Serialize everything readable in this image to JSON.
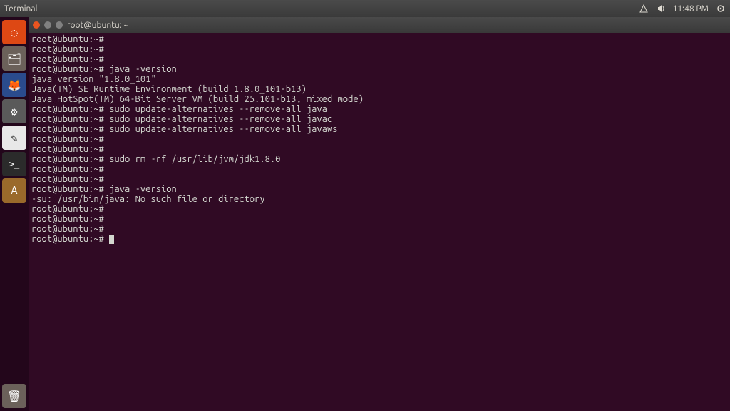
{
  "panel": {
    "active_app": "Terminal",
    "time": "11:48 PM"
  },
  "launcher": {
    "items": [
      {
        "name": "dash-icon",
        "glyph": "◌",
        "bg": "#dd4814"
      },
      {
        "name": "files-icon",
        "glyph": "🗂",
        "bg": "#6b615a"
      },
      {
        "name": "firefox-icon",
        "glyph": "🦊",
        "bg": "#2a4b8d"
      },
      {
        "name": "settings-icon",
        "glyph": "⚙",
        "bg": "#5a5a5a"
      },
      {
        "name": "text-editor-icon",
        "glyph": "✎",
        "bg": "#e8e8e8"
      },
      {
        "name": "terminal-icon",
        "glyph": ">_",
        "bg": "#2b2b2b"
      },
      {
        "name": "software-updater-icon",
        "glyph": "A",
        "bg": "#9a6a2b"
      }
    ],
    "bottom": {
      "name": "trash-icon",
      "glyph": "🗑",
      "bg": "#6b615a"
    }
  },
  "terminal": {
    "title": "root@ubuntu: ~",
    "prompt": "root@ubuntu:~#",
    "lines": [
      {
        "type": "prompt",
        "cmd": ""
      },
      {
        "type": "prompt",
        "cmd": ""
      },
      {
        "type": "prompt",
        "cmd": ""
      },
      {
        "type": "prompt",
        "cmd": "java -version"
      },
      {
        "type": "out",
        "text": "java version \"1.8.0_101\""
      },
      {
        "type": "out",
        "text": "Java(TM) SE Runtime Environment (build 1.8.0_101-b13)"
      },
      {
        "type": "out",
        "text": "Java HotSpot(TM) 64-Bit Server VM (build 25.101-b13, mixed mode)"
      },
      {
        "type": "prompt",
        "cmd": "sudo update-alternatives --remove-all java"
      },
      {
        "type": "prompt",
        "cmd": "sudo update-alternatives --remove-all javac"
      },
      {
        "type": "prompt",
        "cmd": "sudo update-alternatives --remove-all javaws"
      },
      {
        "type": "prompt",
        "cmd": ""
      },
      {
        "type": "prompt",
        "cmd": ""
      },
      {
        "type": "prompt",
        "cmd": "sudo rm -rf /usr/lib/jvm/jdk1.8.0"
      },
      {
        "type": "prompt",
        "cmd": ""
      },
      {
        "type": "prompt",
        "cmd": ""
      },
      {
        "type": "prompt",
        "cmd": "java -version"
      },
      {
        "type": "out",
        "text": "-su: /usr/bin/java: No such file or directory"
      },
      {
        "type": "prompt",
        "cmd": ""
      },
      {
        "type": "prompt",
        "cmd": ""
      },
      {
        "type": "prompt",
        "cmd": ""
      },
      {
        "type": "prompt_cursor",
        "cmd": ""
      }
    ]
  }
}
